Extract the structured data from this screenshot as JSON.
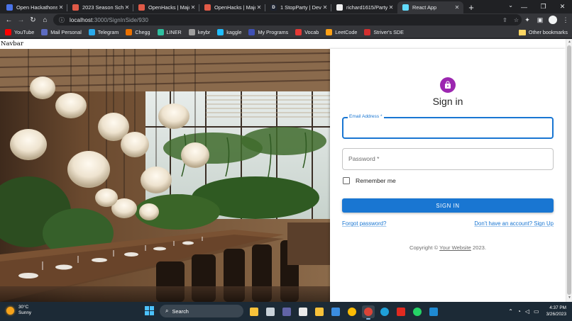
{
  "browser": {
    "tabs": [
      {
        "title": "Open Hackathons |",
        "favicon_color": "#4a73e8",
        "favicon_glyph": ""
      },
      {
        "title": "2023 Season Sched",
        "favicon_color": "#e05a47",
        "favicon_glyph": ""
      },
      {
        "title": "OpenHacks | Major",
        "favicon_color": "#e05a47",
        "favicon_glyph": ""
      },
      {
        "title": "OpenHacks | Major",
        "favicon_color": "#e05a47",
        "favicon_glyph": ""
      },
      {
        "title": "1 StopParty | Devpo",
        "favicon_color": "#1d2330",
        "favicon_glyph": "D"
      },
      {
        "title": "richard1615/PartyFi",
        "favicon_color": "#f0f0f0",
        "favicon_glyph": ""
      },
      {
        "title": "React App",
        "favicon_color": "#61dafb",
        "favicon_glyph": ""
      }
    ],
    "url_host": "localhost",
    "url_path": ":3000/SignInSide/930",
    "bookmarks": [
      {
        "label": "YouTube",
        "icon_color": "#ff0000"
      },
      {
        "label": "Mail Personal",
        "icon_color": "#5c6bc0"
      },
      {
        "label": "Telegram",
        "icon_color": "#29a9eb"
      },
      {
        "label": "Chegg",
        "icon_color": "#eb7100"
      },
      {
        "label": "LINER",
        "icon_color": "#2fbfa0"
      },
      {
        "label": "keybr",
        "icon_color": "#9e9e9e"
      },
      {
        "label": "kaggle",
        "icon_color": "#20beff"
      },
      {
        "label": "My Programs",
        "icon_color": "#3f51b5"
      },
      {
        "label": "Vocab",
        "icon_color": "#e53935"
      },
      {
        "label": "LeetCode",
        "icon_color": "#ffa116"
      },
      {
        "label": "Striver's SDE",
        "icon_color": "#d32f2f"
      }
    ],
    "other_bookmarks": "Other bookmarks"
  },
  "page": {
    "navbar_text": "Navbar",
    "signin": {
      "title": "Sign in",
      "email_label": "Email Address *",
      "email_value": "",
      "password_label": "Password *",
      "remember_label": "Remember me",
      "button_label": "SIGN IN",
      "forgot_link": "Forgot password?",
      "signup_link": "Don't have an account? Sign Up",
      "copyright_prefix": "Copyright © ",
      "copyright_link": "Your Website",
      "copyright_suffix": " 2023.",
      "accent_color": "#1976d2",
      "avatar_color": "#9c27b0"
    }
  },
  "taskbar": {
    "weather_temp": "30°C",
    "weather_desc": "Sunny",
    "search_label": "Search",
    "time": "4:37 PM",
    "date": "3/26/2023",
    "apps": [
      {
        "name": "file-explorer",
        "color": "#f8c23a"
      },
      {
        "name": "task-view",
        "color": "#c9d2da"
      },
      {
        "name": "teams",
        "color": "#6264a7"
      },
      {
        "name": "microsoft-store",
        "color": "#eaeaea"
      },
      {
        "name": "folder",
        "color": "#f8c23a"
      },
      {
        "name": "todo",
        "color": "#3b8de0"
      },
      {
        "name": "chrome",
        "color": "#fbbc05"
      },
      {
        "name": "chrome-alt",
        "color": "#db4437"
      },
      {
        "name": "edge",
        "color": "#1fa0d8"
      },
      {
        "name": "acrobat",
        "color": "#e02a20"
      },
      {
        "name": "whatsapp",
        "color": "#25d366"
      },
      {
        "name": "vscode",
        "color": "#1f8ad2"
      }
    ]
  }
}
